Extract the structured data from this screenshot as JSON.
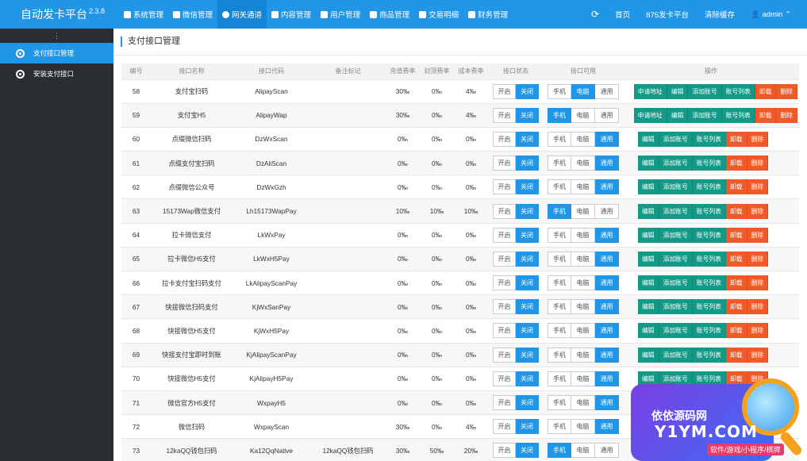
{
  "app": {
    "name": "自动发卡平台",
    "version": "2.3.8"
  },
  "topnav": {
    "items": [
      {
        "label": "系统管理",
        "icon": "gear-icon",
        "active": false
      },
      {
        "label": "微信管理",
        "icon": "wechat-icon",
        "active": false
      },
      {
        "label": "网关通道",
        "icon": "gateway-icon",
        "active": true
      },
      {
        "label": "内容管理",
        "icon": "document-icon",
        "active": false
      },
      {
        "label": "用户管理",
        "icon": "users-icon",
        "active": false
      },
      {
        "label": "商品管理",
        "icon": "bag-icon",
        "active": false
      },
      {
        "label": "交易明细",
        "icon": "chart-icon",
        "active": false
      },
      {
        "label": "财务管理",
        "icon": "money-icon",
        "active": false
      }
    ],
    "right": {
      "refresh_icon": "refresh-icon",
      "home": "首页",
      "site": "875发卡平台",
      "clear_cache": "清除缓存",
      "user": "admin"
    }
  },
  "sidebar": {
    "toggle": "⋮",
    "items": [
      {
        "label": "支付接口管理",
        "active": true
      },
      {
        "label": "安装支付接口",
        "active": false
      }
    ]
  },
  "page": {
    "title": "支付接口管理"
  },
  "table": {
    "headers": [
      "编号",
      "接口名称",
      "接口代码",
      "备注标记",
      "充值费率",
      "封顶费率",
      "成本费率",
      "接口状态",
      "接口可用",
      "操作"
    ],
    "status_labels": {
      "on": "开启",
      "off": "关闭"
    },
    "device_labels": {
      "mobile": "手机",
      "pc": "电脑",
      "all": "通用"
    },
    "op_labels": {
      "apply": "申请地址",
      "edit": "编辑",
      "add_account": "添加账号",
      "account_list": "账号列表",
      "uninstall": "卸载",
      "delete": "删除"
    },
    "rows": [
      {
        "id": "58",
        "name": "支付宝扫码",
        "code": "AlipayScan",
        "note": "",
        "rate": "30‰",
        "cap": "0‰",
        "cost": "4‰",
        "status": "off",
        "avail": "pc",
        "apply": true
      },
      {
        "id": "59",
        "name": "支付宝H5",
        "code": "AlipayWap",
        "note": "",
        "rate": "30‰",
        "cap": "0‰",
        "cost": "4‰",
        "status": "off",
        "avail": "mobile",
        "apply": true
      },
      {
        "id": "60",
        "name": "点缀微信扫码",
        "code": "DzWxScan",
        "note": "",
        "rate": "0‰",
        "cap": "0‰",
        "cost": "0‰",
        "status": "off",
        "avail": "all",
        "apply": false
      },
      {
        "id": "61",
        "name": "点缀支付宝扫码",
        "code": "DzAliScan",
        "note": "",
        "rate": "0‰",
        "cap": "0‰",
        "cost": "0‰",
        "status": "off",
        "avail": "all",
        "apply": false
      },
      {
        "id": "62",
        "name": "点缀微信公众号",
        "code": "DzWxGzh",
        "note": "",
        "rate": "0‰",
        "cap": "0‰",
        "cost": "0‰",
        "status": "off",
        "avail": "all",
        "apply": false
      },
      {
        "id": "63",
        "name": "15173Wap微信支付",
        "code": "Lh15173WapPay",
        "note": "",
        "rate": "10‰",
        "cap": "10‰",
        "cost": "10‰",
        "status": "off",
        "avail": "mobile",
        "apply": false
      },
      {
        "id": "64",
        "name": "拉卡微信支付",
        "code": "LkWxPay",
        "note": "",
        "rate": "0‰",
        "cap": "0‰",
        "cost": "0‰",
        "status": "off",
        "avail": "all",
        "apply": false
      },
      {
        "id": "65",
        "name": "拉卡微信H5支付",
        "code": "LkWxH5Pay",
        "note": "",
        "rate": "0‰",
        "cap": "0‰",
        "cost": "0‰",
        "status": "off",
        "avail": "all",
        "apply": false
      },
      {
        "id": "66",
        "name": "拉卡支付宝扫码支付",
        "code": "LkAlipayScanPay",
        "note": "",
        "rate": "0‰",
        "cap": "0‰",
        "cost": "0‰",
        "status": "off",
        "avail": "all",
        "apply": false
      },
      {
        "id": "67",
        "name": "快接微信扫码支付",
        "code": "KjWxSanPay",
        "note": "",
        "rate": "0‰",
        "cap": "0‰",
        "cost": "0‰",
        "status": "off",
        "avail": "all",
        "apply": false
      },
      {
        "id": "68",
        "name": "快接微信H5支付",
        "code": "KjWxH5Pay",
        "note": "",
        "rate": "0‰",
        "cap": "0‰",
        "cost": "0‰",
        "status": "off",
        "avail": "all",
        "apply": false
      },
      {
        "id": "69",
        "name": "快接支付宝即时到账",
        "code": "KjAlipayScanPay",
        "note": "",
        "rate": "0‰",
        "cap": "0‰",
        "cost": "0‰",
        "status": "off",
        "avail": "all",
        "apply": false
      },
      {
        "id": "70",
        "name": "快接微信H5支付",
        "code": "KjAlipayH5Pay",
        "note": "",
        "rate": "0‰",
        "cap": "0‰",
        "cost": "0‰",
        "status": "off",
        "avail": "all",
        "apply": false
      },
      {
        "id": "71",
        "name": "微信官方H5支付",
        "code": "WxpayH5",
        "note": "",
        "rate": "0‰",
        "cap": "0‰",
        "cost": "0‰",
        "status": "off",
        "avail": "all",
        "apply": false
      },
      {
        "id": "72",
        "name": "微信扫码",
        "code": "WxpayScan",
        "note": "",
        "rate": "30‰",
        "cap": "0‰",
        "cost": "4‰",
        "status": "off",
        "avail": "all",
        "apply": false
      },
      {
        "id": "73",
        "name": "12kaQQ钱包扫码",
        "code": "Ka12QqNative",
        "note": "12kaQQ钱包扫码",
        "rate": "30‰",
        "cap": "50‰",
        "cost": "20‰",
        "status": "off",
        "avail": "mobile",
        "apply": false
      }
    ]
  },
  "watermark": {
    "line1": "依依源码网",
    "line2": "Y1YM.COM",
    "line3": "软件/游戏/小程序/棋牌"
  }
}
